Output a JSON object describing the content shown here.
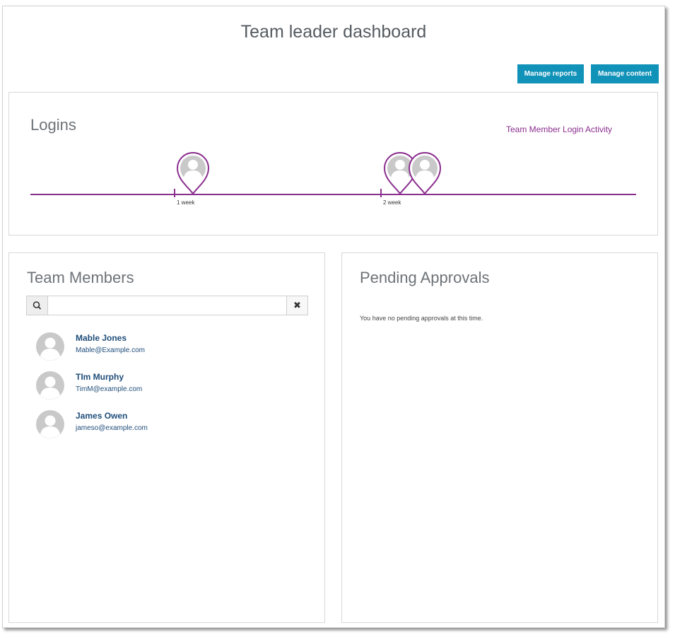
{
  "page": {
    "title": "Team leader dashboard"
  },
  "toolbar": {
    "manage_reports_label": "Manage reports",
    "manage_content_label": "Manage content",
    "button_color": "#1192b9"
  },
  "logins": {
    "heading": "Logins",
    "activity_link": "Team Member Login Activity",
    "timeline_color": "#8b2f8f",
    "ticks": [
      {
        "label": "1 week"
      },
      {
        "label": "2 week"
      }
    ],
    "login_pins": [
      {
        "icon": "user-location-pin-icon"
      },
      {
        "icon": "user-location-pin-icon"
      },
      {
        "icon": "user-location-pin-icon"
      }
    ]
  },
  "team_members": {
    "heading": "Team Members",
    "search": {
      "value": "",
      "placeholder": ""
    },
    "icons": {
      "search": "search-icon",
      "clear": "close-icon",
      "avatar": "user-avatar-icon"
    },
    "members": [
      {
        "name": "Mable Jones",
        "email": "Mable@Example.com"
      },
      {
        "name": "TIm Murphy",
        "email": "TimM@example.com"
      },
      {
        "name": "James Owen",
        "email": "jameso@example.com"
      }
    ]
  },
  "pending_approvals": {
    "heading": "Pending Approvals",
    "empty_message": "You have no pending approvals at this time."
  }
}
